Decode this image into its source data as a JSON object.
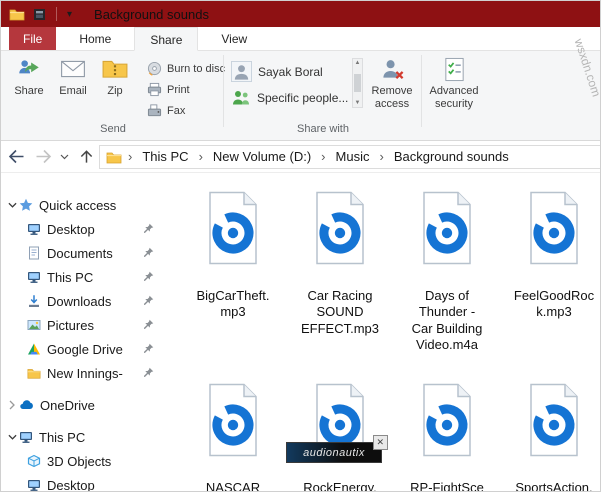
{
  "titlebar": {
    "title": "Background sounds"
  },
  "watermark": {
    "text": "wsxdn.com"
  },
  "tabs": {
    "file": "File",
    "home": "Home",
    "share": "Share",
    "view": "View"
  },
  "ribbon": {
    "send_group": {
      "label": "Send",
      "share": "Share",
      "email": "Email",
      "zip": "Zip",
      "burn": "Burn to disc",
      "print": "Print",
      "fax": "Fax"
    },
    "share_with_group": {
      "label": "Share with",
      "person1": "Sayak Boral",
      "person2": "Specific people...",
      "remove_access": "Remove access"
    },
    "advanced_security": "Advanced security"
  },
  "address_bar": {
    "crumbs": [
      "This PC",
      "New Volume (D:)",
      "Music",
      "Background sounds"
    ]
  },
  "sidebar": {
    "items": [
      {
        "label": "Quick access"
      },
      {
        "label": "Desktop"
      },
      {
        "label": "Documents"
      },
      {
        "label": "This PC"
      },
      {
        "label": "Downloads"
      },
      {
        "label": "Pictures"
      },
      {
        "label": "Google Drive"
      },
      {
        "label": "New Innings-"
      },
      {
        "label": "OneDrive"
      },
      {
        "label": "This PC"
      },
      {
        "label": "3D Objects"
      },
      {
        "label": "Desktop"
      }
    ]
  },
  "files": [
    {
      "label": "BigCarTheft.\nmp3"
    },
    {
      "label": "Car Racing\nSOUND\nEFFECT.mp3"
    },
    {
      "label": "Days of\nThunder -\nCar Building\nVideo.m4a"
    },
    {
      "label": "FeelGoodRoc\nk.mp3"
    },
    {
      "label": "NASCAR"
    },
    {
      "label": "RockEnergy."
    },
    {
      "label": "RP-FightSce"
    },
    {
      "label": "SportsAction."
    }
  ],
  "overlay_ad": {
    "text": "audionautix",
    "close": "✕"
  },
  "colors": {
    "titlebar": "#8e1113",
    "file_tab": "#b5373d",
    "accent_blue": "#1574d4"
  }
}
